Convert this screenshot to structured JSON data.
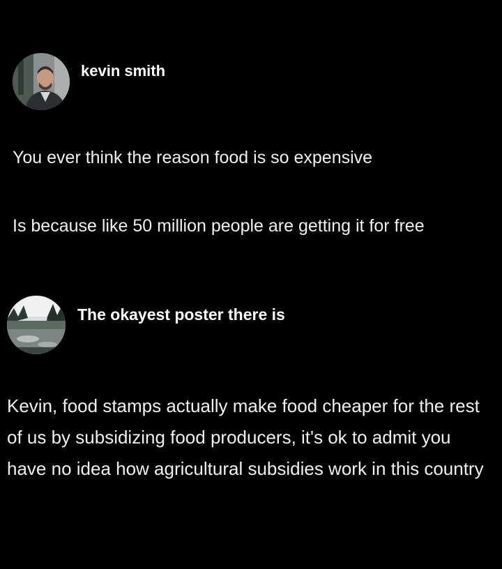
{
  "posts": [
    {
      "author": "kevin smith",
      "avatar_icon": "profile-photo-man",
      "paragraphs": [
        "You ever think the reason food is so expensive",
        "Is because like 50 million people are getting it for free"
      ]
    },
    {
      "author": "The okayest poster there is",
      "avatar_icon": "profile-photo-landscape",
      "paragraphs": [
        "Kevin, food stamps actually make food cheaper for the rest of us by subsidizing food producers, it's ok to admit you have no idea how agricultural subsidies work in this country"
      ]
    }
  ],
  "colors": {
    "background": "#000000",
    "text": "#f0f0f0",
    "author": "#ffffff"
  }
}
